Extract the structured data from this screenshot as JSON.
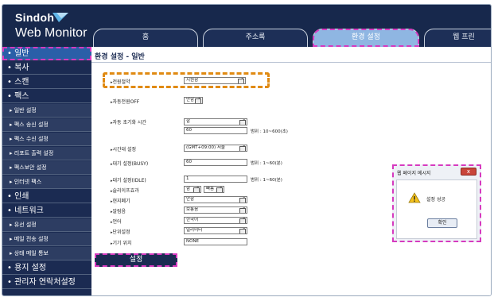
{
  "header": {
    "brand": "Sindoh",
    "product": "Web Monitor",
    "tabs": [
      "홈",
      "주소록",
      "환경 설정",
      "웹 프린"
    ],
    "active_tab": "환경 설정"
  },
  "sidebar": {
    "items": [
      {
        "label": "• 일반",
        "level": "major",
        "selected": true
      },
      {
        "label": "• 복사",
        "level": "major"
      },
      {
        "label": "• 스캔",
        "level": "major"
      },
      {
        "label": "• 팩스",
        "level": "major"
      },
      {
        "label": "▸ 일반 설정",
        "level": "sub"
      },
      {
        "label": "▸ 팩스 송신 설정",
        "level": "sub"
      },
      {
        "label": "▸ 팩스 수신 설정",
        "level": "sub"
      },
      {
        "label": "▸ 리포트 출력 설정",
        "level": "sub"
      },
      {
        "label": "▸ 팩스보안 설정",
        "level": "sub"
      },
      {
        "label": "▸ 인터넷 팩스",
        "level": "sub"
      },
      {
        "label": "• 인쇄",
        "level": "major"
      },
      {
        "label": "• 네트워크",
        "level": "major"
      },
      {
        "label": "▸ 유선 설정",
        "level": "sub"
      },
      {
        "label": "▸ 메일 전송 설정",
        "level": "sub"
      },
      {
        "label": "▸ 상태 메일 통보",
        "level": "sub"
      },
      {
        "label": "• 용지 설정",
        "level": "major"
      },
      {
        "label": "• 관리자 연락처설정",
        "level": "major"
      }
    ]
  },
  "main": {
    "title": "환경 설정 - 일반",
    "fields": {
      "power_saving": {
        "label": "전원절약",
        "value": "지원함"
      },
      "auto_power_off": {
        "label": "자동전원OFF",
        "value": "안함"
      },
      "auto_reset": {
        "label": "자동 초기화 시간",
        "value": "함",
        "input": "60",
        "hint": "범위 : 10~600(초)"
      },
      "timezone": {
        "label": "시간대 설정",
        "value": "(GMT+09:00) 서울"
      },
      "wait_busy": {
        "label": "대기 설정(BUSY)",
        "input": "60",
        "hint": "범위 : 1~60(분)"
      },
      "wait_idle": {
        "label": "대기 설정(IDLE)",
        "input": "1",
        "hint": "범위 : 1~60(분)"
      },
      "sleep": {
        "label": "슬리이프효과",
        "value": "함",
        "value2": "빠름"
      },
      "toner_save": {
        "label": "현지폐기",
        "value": "안함"
      },
      "alarm": {
        "label": "알림음",
        "value": "보통음"
      },
      "language": {
        "label": "언어",
        "value": "한국어"
      },
      "unit": {
        "label": "단위설정",
        "value": "밀리미터"
      },
      "location": {
        "label": "기기 위치",
        "input": "NONE"
      }
    },
    "save_label": "설정"
  },
  "dialog": {
    "title": "웹 페이지 메시지",
    "message": "설정 성공",
    "ok_label": "확인",
    "close_glyph": "x"
  },
  "colors": {
    "navy": "#1b2b52",
    "accent_highlight": "#e08a12",
    "annotation_dash": "#d63abf",
    "active_tab": "#8fb6e2"
  }
}
